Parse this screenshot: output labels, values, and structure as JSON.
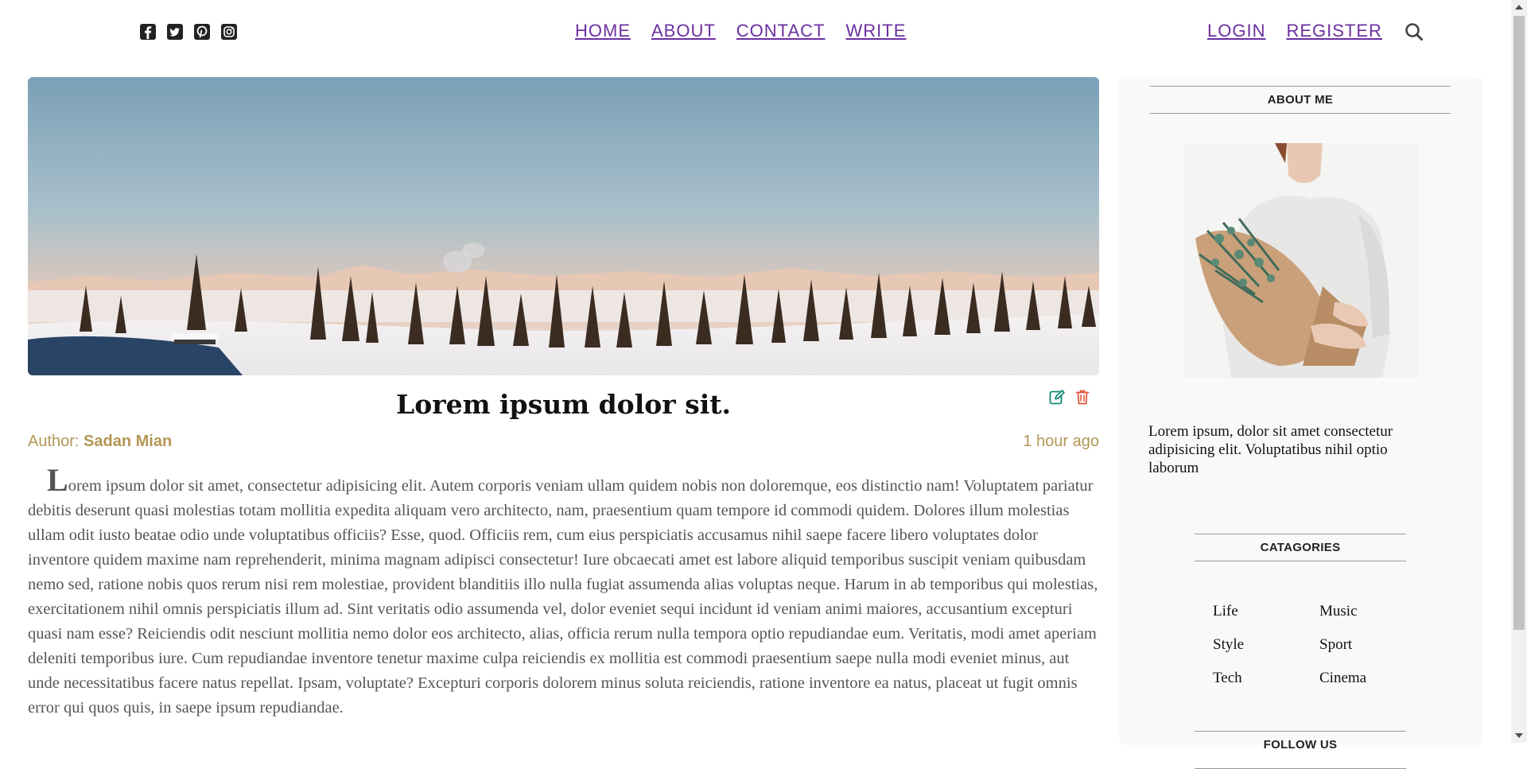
{
  "header": {
    "social_icons": [
      "facebook-square-icon",
      "twitter-square-icon",
      "pinterest-square-icon",
      "instagram-square-icon"
    ],
    "nav_center": [
      "HOME",
      "ABOUT",
      "CONTACT",
      "WRITE"
    ],
    "nav_right": [
      "LOGIN",
      "REGISTER"
    ],
    "search_icon": "search-icon",
    "link_color": "#6b2fa0"
  },
  "post": {
    "title": "Lorem ipsum dolor sit.",
    "author_label": "Author:",
    "author_name": "Sadan Mian",
    "time_ago": "1 hour ago",
    "first_letter": "L",
    "body": "orem ipsum dolor sit amet, consectetur adipisicing elit. Autem corporis veniam ullam quidem nobis non doloremque, eos distinctio nam! Voluptatem pariatur debitis deserunt quasi molestias totam mollitia expedita aliquam vero architecto, nam, praesentium quam tempore id commodi quidem. Dolores illum molestias ullam odit iusto beatae odio unde voluptatibus officiis? Esse, quod. Officiis rem, cum eius perspiciatis accusamus nihil saepe facere libero voluptates dolor inventore quidem maxime nam reprehenderit, minima magnam adipisci consectetur! Iure obcaecati amet est labore aliquid temporibus suscipit veniam quibusdam nemo sed, ratione nobis quos rerum nisi rem molestiae, provident blanditiis illo nulla fugiat assumenda alias voluptas neque. Harum in ab temporibus qui molestias, exercitationem nihil omnis perspiciatis illum ad. Sint veritatis odio assumenda vel, dolor eveniet sequi incidunt id veniam animi maiores, accusantium excepturi quasi nam esse? Reiciendis odit nesciunt mollitia nemo dolor eos architecto, alias, officia rerum nulla tempora optio repudiandae eum. Veritatis, modi amet aperiam deleniti temporibus iure. Cum repudiandae inventore tenetur maxime culpa reiciendis ex mollitia est commodi praesentium saepe nulla modi eveniet minus, aut unde necessitatibus facere natus repellat. Ipsam, voluptate? Excepturi corporis dolorem minus soluta reiciendis, ratione inventore ea natus, placeat ut fugit omnis error qui quos quis, in saepe ipsum repudiandae.",
    "edit_icon": "edit-icon",
    "delete_icon": "trash-icon",
    "edit_color": "#138a72",
    "delete_color": "#e0573a",
    "meta_color": "#b39656"
  },
  "sidebar": {
    "about_title": "ABOUT ME",
    "about_text": "Lorem ipsum, dolor sit amet consectetur adipisicing elit. Voluptatibus nihil optio laborum",
    "categories_title": "CATAGORIES",
    "categories": [
      "Life",
      "Music",
      "Style",
      "Sport",
      "Tech",
      "Cinema"
    ],
    "follow_title": "FOLLOW US"
  }
}
